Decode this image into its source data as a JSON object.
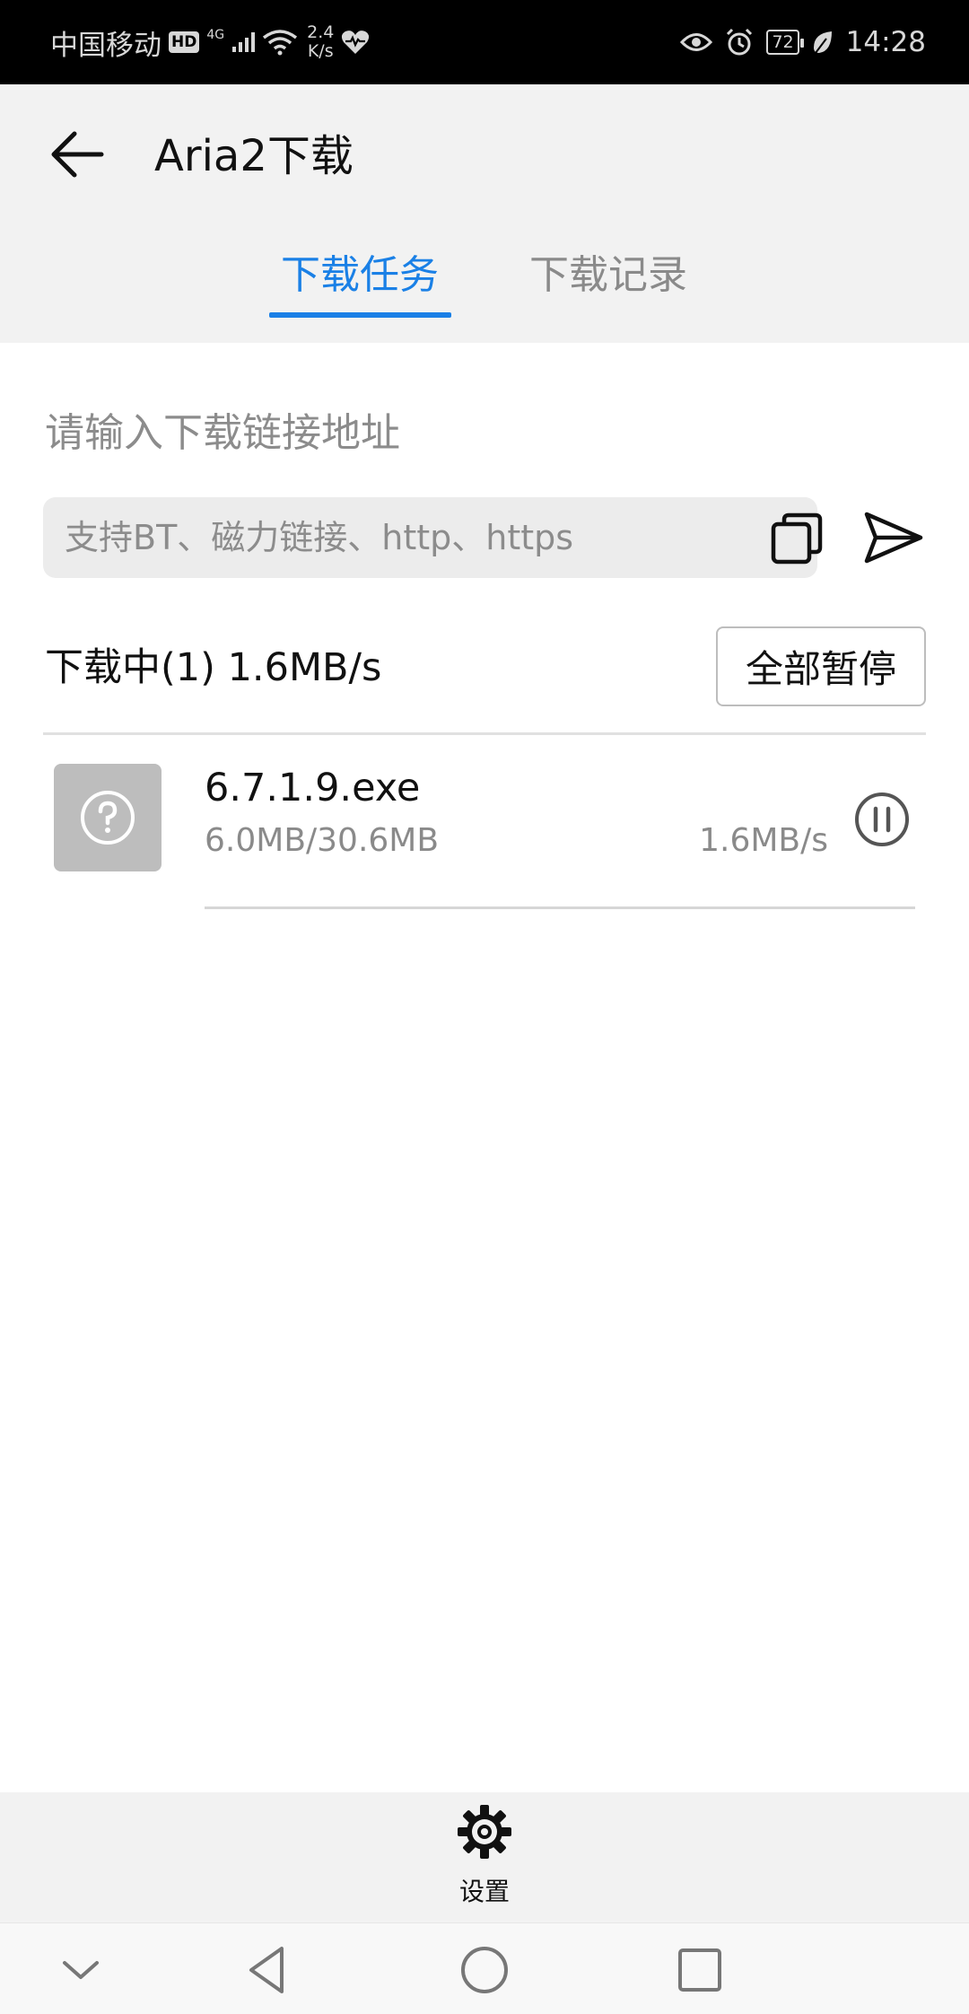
{
  "status_bar": {
    "carrier": "中国移动",
    "hd_badge": "HD",
    "signal_label": "4G",
    "net_speed_value": "2.4",
    "net_speed_unit": "K/s",
    "battery": "72",
    "time": "14:28"
  },
  "header": {
    "title": "Aria2下载",
    "tabs": [
      {
        "label": "下载任务",
        "active": true
      },
      {
        "label": "下载记录",
        "active": false
      }
    ]
  },
  "main": {
    "url_hint": "请输入下载链接地址",
    "url_input": {
      "value": "",
      "placeholder": "支持BT、磁力链接、http、https"
    },
    "downloading_status": "下载中(1) 1.6MB/s",
    "pause_all_label": "全部暂停",
    "tasks": [
      {
        "name": "6.7.1.9.exe",
        "progress_text": "6.0MB/30.6MB",
        "speed": "1.6MB/s",
        "icon": "unknown-file-icon"
      }
    ]
  },
  "bottom_toolbar": {
    "settings_label": "设置"
  },
  "colors": {
    "accent": "#1a80e6",
    "header_bg": "#f2f2f2",
    "status_bar_bg": "#000000",
    "muted_text": "#8a8a8a"
  }
}
